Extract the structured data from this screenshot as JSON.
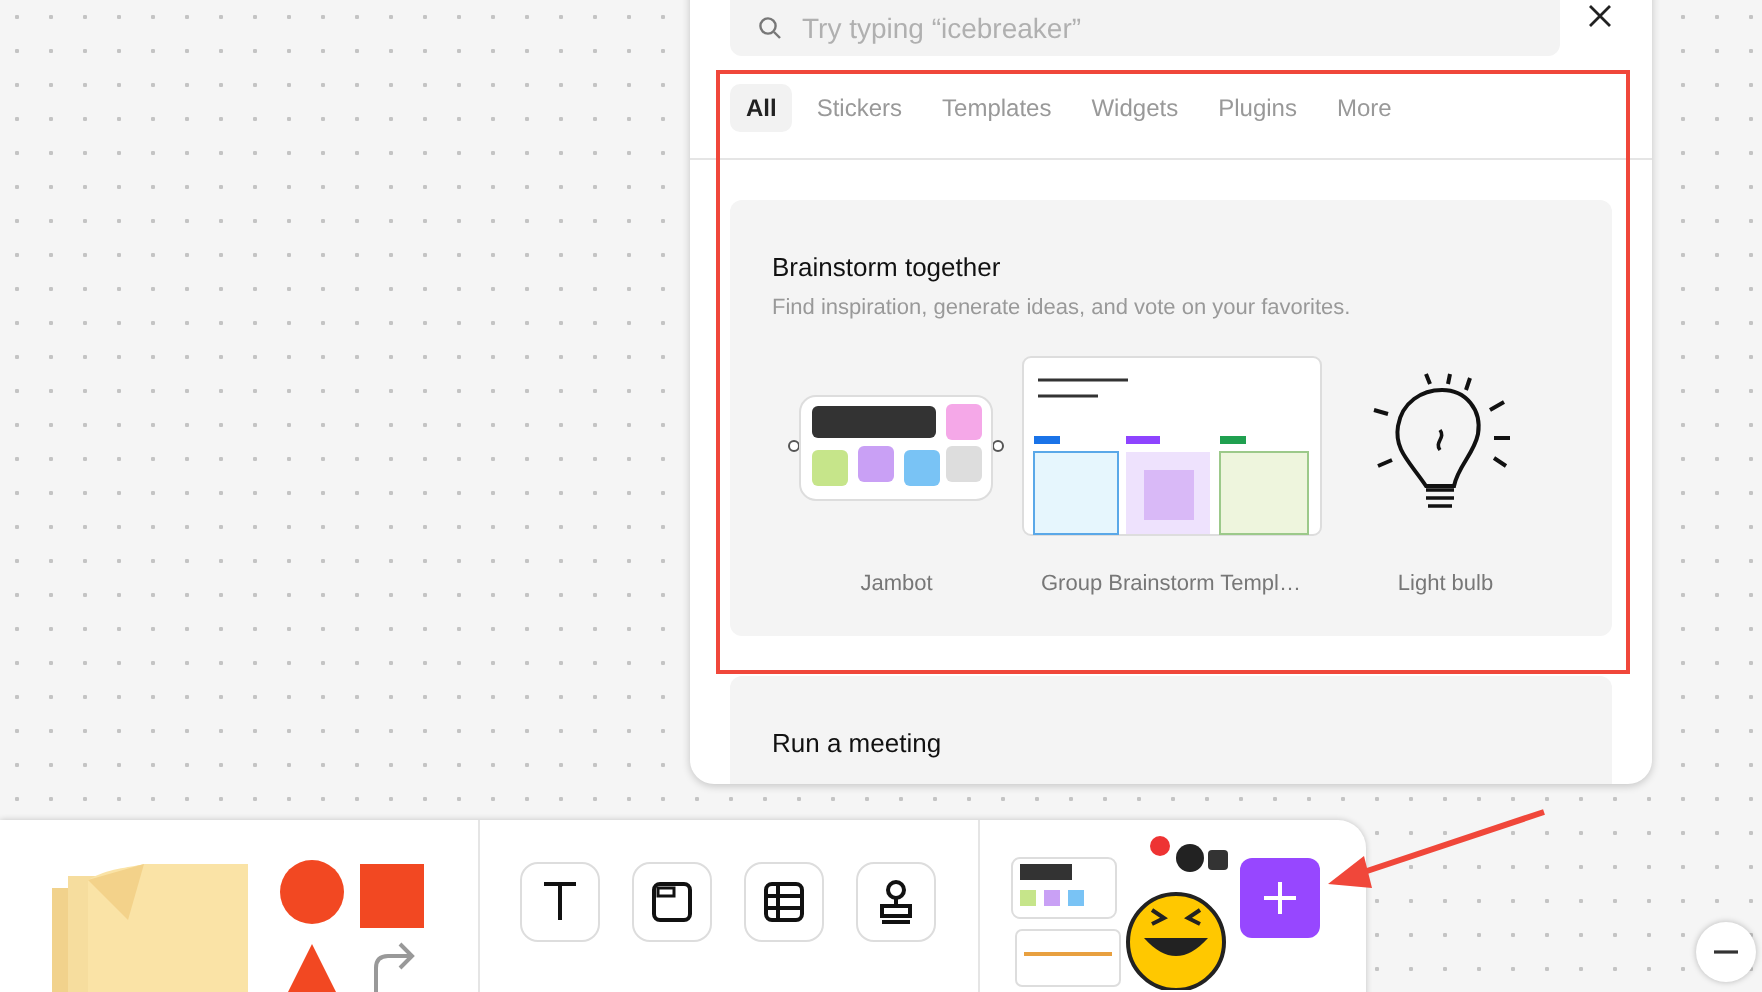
{
  "search": {
    "placeholder": "Try typing “icebreaker”"
  },
  "tabs": [
    {
      "label": "All",
      "selected": true
    },
    {
      "label": "Stickers",
      "selected": false
    },
    {
      "label": "Templates",
      "selected": false
    },
    {
      "label": "Widgets",
      "selected": false
    },
    {
      "label": "Plugins",
      "selected": false
    },
    {
      "label": "More",
      "selected": false
    }
  ],
  "sections": [
    {
      "title": "Brainstorm together",
      "description": "Find inspiration, generate ideas, and vote on your favorites.",
      "items": [
        {
          "kind": "jambot",
          "label": "Jambot"
        },
        {
          "kind": "template",
          "label": "Group Brainstorm Templ…"
        },
        {
          "kind": "bulb",
          "label": "Light bulb"
        }
      ]
    },
    {
      "title": "Run a meeting"
    }
  ],
  "tools": [
    {
      "kind": "text"
    },
    {
      "kind": "section"
    },
    {
      "kind": "table"
    },
    {
      "kind": "stamp"
    }
  ]
}
